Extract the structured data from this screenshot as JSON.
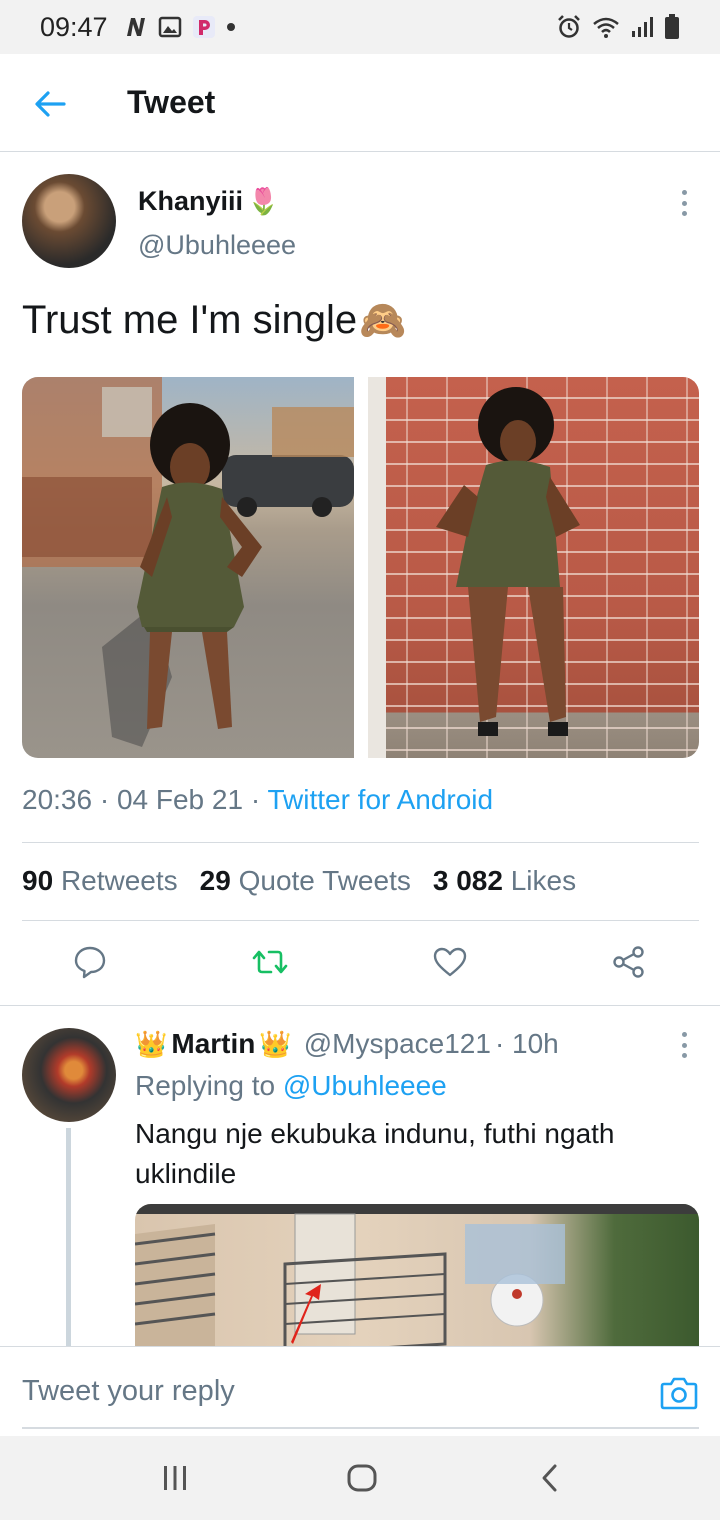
{
  "status_bar": {
    "time": "09:47",
    "left_icons": [
      "n-icon",
      "image-icon",
      "p-app-icon",
      "dot-icon"
    ],
    "right_icons": [
      "alarm-icon",
      "wifi-icon",
      "signal-icon",
      "battery-icon"
    ]
  },
  "header": {
    "title": "Tweet"
  },
  "tweet": {
    "name": "Khanyiii",
    "name_emoji": "🌷",
    "handle": "@Ubuhleeee",
    "text": "Trust me I'm single",
    "text_emoji": "🙈",
    "time_date": "20:36 · 04 Feb 21 · ",
    "source": "Twitter for Android",
    "stats": {
      "retweets_count": "90",
      "retweets_label": "Retweets",
      "quotes_count": "29",
      "quotes_label": "Quote Tweets",
      "likes_count": "3 082",
      "likes_label": "Likes"
    },
    "accent": "#1da1f2",
    "retweet_color": "#17bf63"
  },
  "reply": {
    "crown": "👑",
    "name": "Martin",
    "handle": "@Myspace121",
    "age": " · 10h",
    "replying_prefix": "Replying to ",
    "replying_to": "@Ubuhleeee",
    "text": "Nangu nje ekubuka indunu, futhi ngath uklindile"
  },
  "reply_box": {
    "placeholder": "Tweet your reply"
  },
  "nav_bar": {
    "buttons": [
      "recents-button",
      "home-button",
      "back-button"
    ]
  }
}
